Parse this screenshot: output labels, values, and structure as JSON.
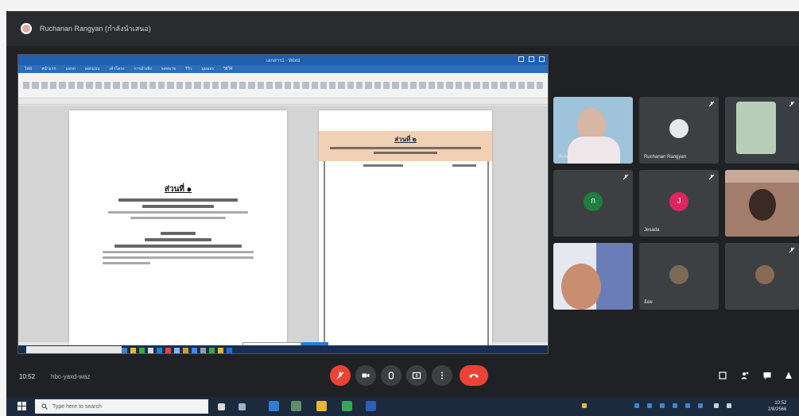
{
  "presenter": {
    "name": "Ruchanan Rangyan (กำลังนำเสนอ)"
  },
  "word": {
    "title": "เอกสาร1 - Word",
    "ribbon_tabs": [
      "ไฟล์",
      "หน้าแรก",
      "แทรก",
      "ออกแบบ",
      "เค้าโครง",
      "การอ้างอิง",
      "จดหมาย",
      "รีวิว",
      "มุมมอง",
      "วิธีใช้"
    ],
    "page1": {
      "heading": "ส่วนที่ ๑"
    },
    "page2": {
      "heading": "ส่วนที่ ๒"
    }
  },
  "participants": [
    {
      "name": "Rungnapha P.",
      "type": "video"
    },
    {
      "name": "Ruchanan Rangyan",
      "type": "avatar",
      "initial": ""
    },
    {
      "name": "",
      "type": "video"
    },
    {
      "name": "",
      "type": "avatar",
      "initial": "ก"
    },
    {
      "name": "Jesada",
      "type": "avatar",
      "initial": "J"
    },
    {
      "name": "",
      "type": "video"
    },
    {
      "name": "",
      "type": "video"
    },
    {
      "name": "อ้อย",
      "type": "avatar",
      "initial": ""
    },
    {
      "name": "",
      "type": "avatar",
      "initial": ""
    }
  ],
  "meeting": {
    "time": "10:52",
    "code": "hbc-yaxd-waz"
  },
  "taskbar": {
    "search_placeholder": "Type here to search",
    "clock_time": "10:52",
    "clock_date": "2/8/2566"
  },
  "colors": {
    "meet_bg": "#202124",
    "tile_bg": "#3c4043",
    "end_call": "#ea4335",
    "word_blue": "#2b6cbb",
    "section_banner": "#f1d0b6"
  }
}
